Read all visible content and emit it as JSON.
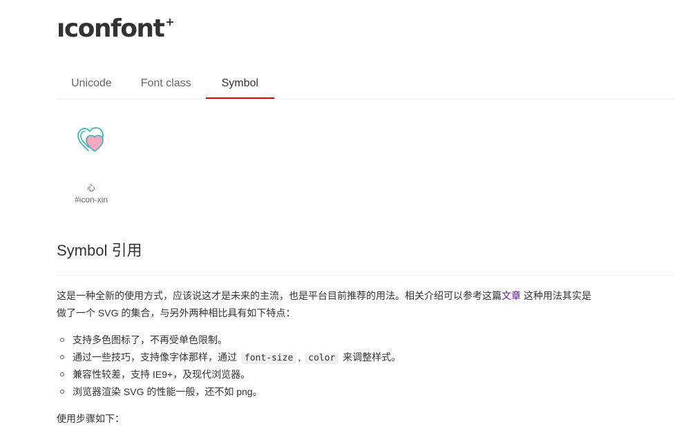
{
  "logo": {
    "text": "ıconfont",
    "superscript": "+"
  },
  "tabs": [
    {
      "label": "Unicode",
      "active": false
    },
    {
      "label": "Font class",
      "active": false
    },
    {
      "label": "Symbol",
      "active": true
    }
  ],
  "icons": [
    {
      "name": "心",
      "code": "#icon-xin",
      "icon": "heart-icon",
      "colors": {
        "outline": "#3ab5b0",
        "fill": "#f7a8c0"
      }
    }
  ],
  "section": {
    "title": "Symbol 引用",
    "intro_before_link": "这是一种全新的使用方式，应该说这才是未来的主流，也是平台目前推荐的用法。相关介绍可以参考这篇",
    "link_text": "文章",
    "intro_after_link": " 这种用法其实是做了一个 SVG 的集合，与另外两种相比具有如下特点：",
    "features": [
      {
        "text": "支持多色图标了，不再受单色限制。"
      },
      {
        "before": "通过一些技巧，支持像字体那样，通过",
        "code1": "font-size",
        "separator": ",",
        "code2": "color",
        "after": "来调整样式。"
      },
      {
        "text": "兼容性较差，支持 IE9+，及现代浏览器。"
      },
      {
        "text": "浏览器渲染 SVG 的性能一般，还不如 png。"
      }
    ],
    "steps_intro": "使用步骤如下："
  },
  "colors": {
    "active_tab_underline": "#e50000",
    "link": "#551a8b",
    "text": "#333333",
    "code_bg": "#f0f0f0"
  }
}
